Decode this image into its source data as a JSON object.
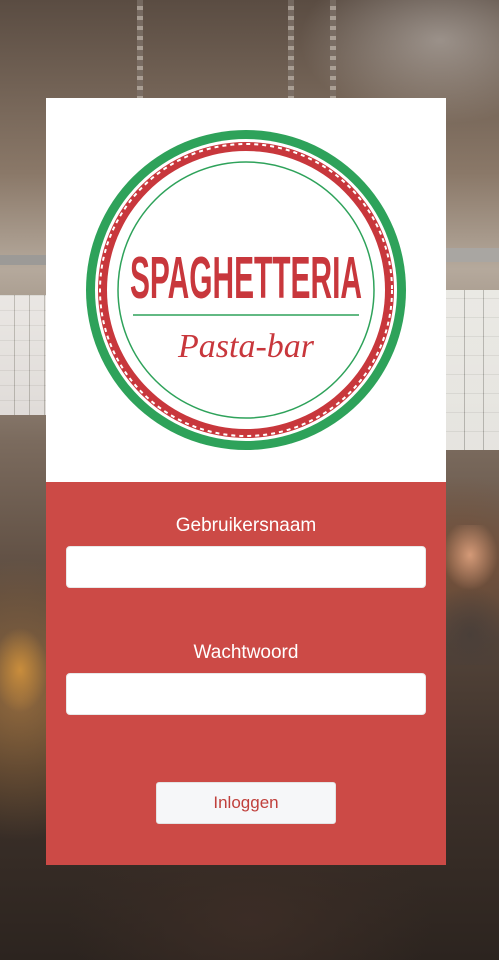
{
  "logo": {
    "title": "SPAGHETTERIA",
    "subtitle": "Pasta-bar"
  },
  "form": {
    "username_label": "Gebruikersnaam",
    "username_value": "",
    "password_label": "Wachtwoord",
    "password_value": "",
    "submit_label": "Inloggen"
  },
  "colors": {
    "brand_red": "#cc4a46",
    "logo_green": "#2ea25a",
    "logo_red": "#c8373c"
  }
}
